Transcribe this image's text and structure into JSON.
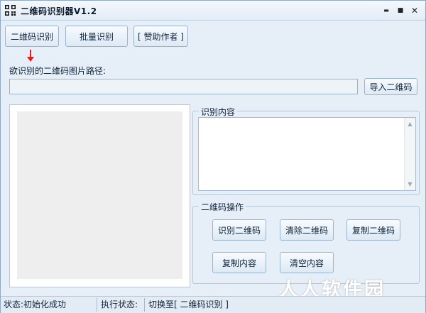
{
  "window": {
    "title": "二维码识别器V1.2",
    "minimize_glyph": "▬",
    "maximize_glyph": "■",
    "close_glyph": "✕"
  },
  "toolbar": {
    "recognize_tab": "二维码识别",
    "batch_tab": "批量识别",
    "donate": "[ 赞助作者 ]"
  },
  "path": {
    "label": "欲识别的二维码图片路径:",
    "value": "",
    "import_button": "导入二维码"
  },
  "result": {
    "group_title": "识别内容",
    "content": ""
  },
  "operations": {
    "group_title": "二维码操作",
    "recognize": "识别二维码",
    "clear_qr": "清除二维码",
    "copy_qr": "复制二维码",
    "copy_content": "复制内容",
    "clear_content": "清空内容"
  },
  "status": {
    "state": "状态:初始化成功",
    "exec_label": "执行状态:",
    "exec_value": "切换至[ 二维码识别 ]"
  },
  "watermark": "人人软件园",
  "colors": {
    "arrow": "#e02020",
    "accent_border": "#9bb4cd"
  },
  "icons": {
    "app": "qr-code-icon",
    "indicator": "down-arrow-icon"
  }
}
